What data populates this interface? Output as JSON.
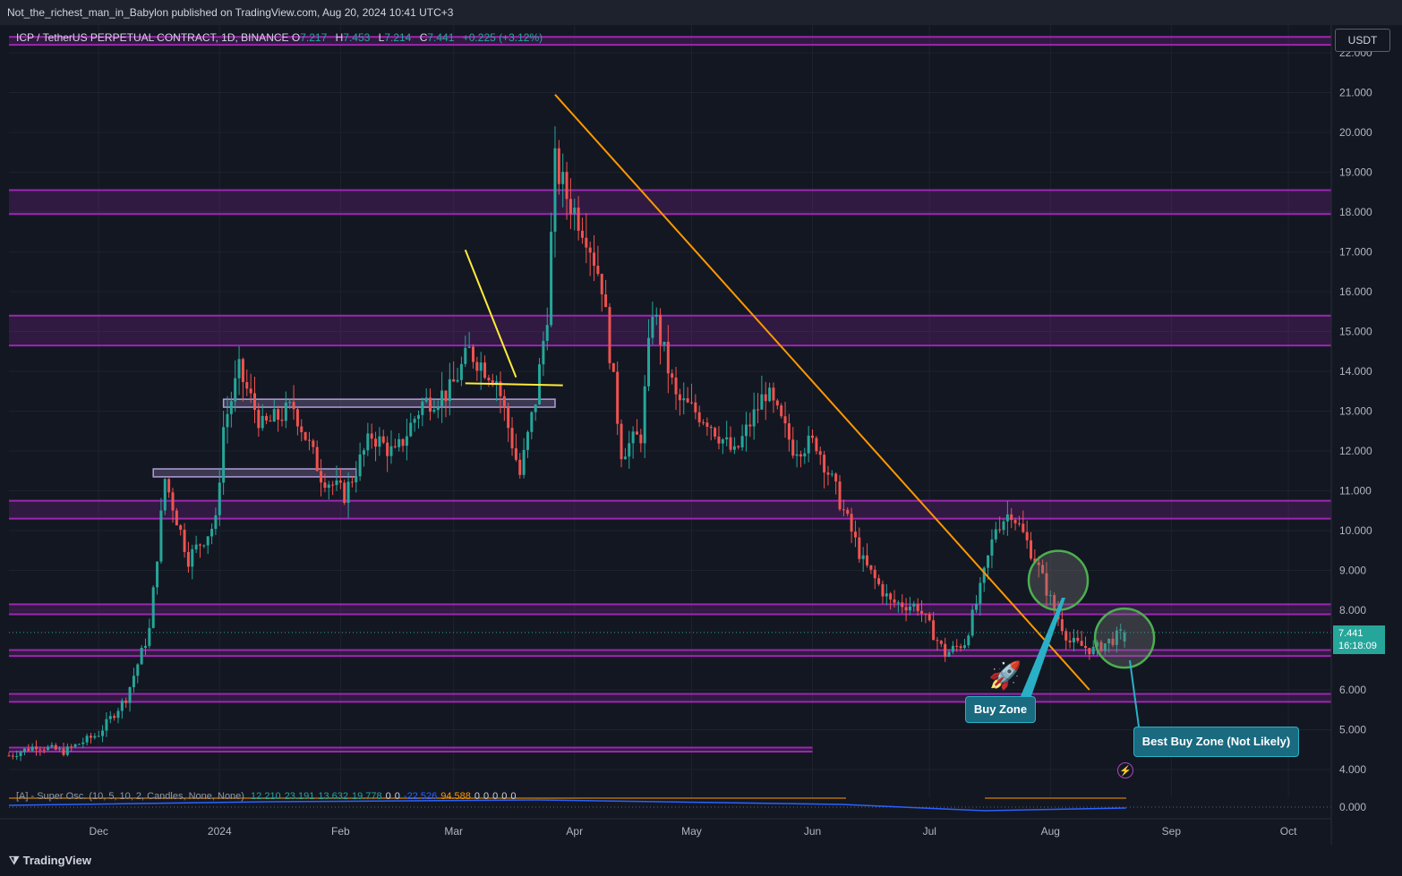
{
  "header": {
    "publisher": "Not_the_richest_man_in_Babylon published on TradingView.com, Aug 20, 2024 10:41 UTC+3"
  },
  "legend": {
    "symbol": "ICP / TetherUS PERPETUAL CONTRACT, 1D, BINANCE",
    "open_label": "O",
    "open": "7.217",
    "high_label": "H",
    "high": "7.453",
    "low_label": "L",
    "low": "7.214",
    "close_label": "C",
    "close": "7.441",
    "change": "+0.225 (+3.12%)"
  },
  "currency_button": "USDT",
  "price_label": {
    "price": "7.441",
    "countdown": "16:18:09"
  },
  "annotations": {
    "buy_zone": "Buy Zone",
    "best_buy_zone": "Best Buy Zone (Not Likely)",
    "rocket_icon": "🚀",
    "flash_icon": "⚡"
  },
  "indicator": {
    "name": "[A] - Super Osc. (10, 5, 10, 2, Candles, None, None)",
    "values": [
      "12.210",
      "23.191",
      "13.632",
      "19.778",
      "0",
      "0",
      "-22.526",
      "94.588",
      "0",
      "0",
      "0",
      "0",
      "0"
    ],
    "value_colors": [
      "#26a69a",
      "#26a69a",
      "#26a69a",
      "#26a69a",
      "#d1d4dc",
      "#d1d4dc",
      "#2962ff",
      "#ff9800",
      "#d1d4dc",
      "#d1d4dc",
      "#d1d4dc",
      "#d1d4dc",
      "#d1d4dc"
    ],
    "axis_label": "0.000"
  },
  "footer": {
    "brand": "TradingView",
    "logo_icon": "tradingview-logo"
  },
  "chart_data": {
    "type": "candlestick",
    "y_axis": {
      "ticks": [
        "22.000",
        "21.000",
        "20.000",
        "19.000",
        "18.000",
        "17.000",
        "16.000",
        "15.000",
        "14.000",
        "13.000",
        "12.000",
        "11.000",
        "10.000",
        "9.000",
        "8.000",
        "6.000",
        "5.000",
        "4.000"
      ],
      "range": [
        3.3,
        22.4
      ]
    },
    "x_axis": {
      "ticks": [
        "Dec",
        "2024",
        "Feb",
        "Mar",
        "Apr",
        "May",
        "Jun",
        "Jul",
        "Aug",
        "Sep",
        "Oct"
      ],
      "tick_dates": [
        "2023-12-01",
        "2024-01-01",
        "2024-02-01",
        "2024-03-01",
        "2024-04-01",
        "2024-05-01",
        "2024-06-01",
        "2024-07-01",
        "2024-08-01",
        "2024-09-01",
        "2024-10-01"
      ],
      "range": [
        "2023-11-08",
        "2024-10-12"
      ]
    },
    "last_price": 7.441,
    "colors": {
      "up": "#26a69a",
      "down": "#ef5350",
      "zone": "#9c27b0",
      "trend": "#ff9800",
      "yellow": "#ffeb3b"
    },
    "series_anchors": [
      [
        "2023-11-08",
        4.35
      ],
      [
        "2023-11-15",
        4.6
      ],
      [
        "2023-11-22",
        4.45
      ],
      [
        "2023-12-01",
        4.9
      ],
      [
        "2023-12-08",
        5.8
      ],
      [
        "2023-12-14",
        7.5
      ],
      [
        "2023-12-18",
        11.3
      ],
      [
        "2023-12-24",
        9.3
      ],
      [
        "2023-12-31",
        10.2
      ],
      [
        "2024-01-02",
        12.6
      ],
      [
        "2024-01-06",
        14.0
      ],
      [
        "2024-01-12",
        12.6
      ],
      [
        "2024-01-20",
        13.1
      ],
      [
        "2024-01-27",
        11.4
      ],
      [
        "2024-02-02",
        10.9
      ],
      [
        "2024-02-09",
        12.4
      ],
      [
        "2024-02-15",
        11.9
      ],
      [
        "2024-02-22",
        13.2
      ],
      [
        "2024-02-29",
        13.5
      ],
      [
        "2024-03-05",
        14.5
      ],
      [
        "2024-03-12",
        13.8
      ],
      [
        "2024-03-18",
        11.4
      ],
      [
        "2024-03-22",
        13.3
      ],
      [
        "2024-03-25",
        15.5
      ],
      [
        "2024-03-27",
        19.2
      ],
      [
        "2024-03-30",
        18.4
      ],
      [
        "2024-04-04",
        17.5
      ],
      [
        "2024-04-08",
        16.2
      ],
      [
        "2024-04-13",
        12.0
      ],
      [
        "2024-04-18",
        12.4
      ],
      [
        "2024-04-21",
        15.6
      ],
      [
        "2024-04-27",
        13.3
      ],
      [
        "2024-05-05",
        12.8
      ],
      [
        "2024-05-12",
        11.9
      ],
      [
        "2024-05-20",
        13.5
      ],
      [
        "2024-05-27",
        12.1
      ],
      [
        "2024-06-02",
        12.2
      ],
      [
        "2024-06-07",
        11.0
      ],
      [
        "2024-06-14",
        9.2
      ],
      [
        "2024-06-21",
        8.2
      ],
      [
        "2024-06-28",
        8.1
      ],
      [
        "2024-07-05",
        6.9
      ],
      [
        "2024-07-10",
        7.2
      ],
      [
        "2024-07-14",
        8.5
      ],
      [
        "2024-07-18",
        10.1
      ],
      [
        "2024-07-22",
        10.5
      ],
      [
        "2024-07-28",
        9.3
      ],
      [
        "2024-08-02",
        8.0
      ],
      [
        "2024-08-06",
        7.2
      ],
      [
        "2024-08-12",
        7.0
      ],
      [
        "2024-08-20",
        7.441
      ]
    ],
    "zones": [
      {
        "from": "2023-11-08",
        "to": "2024-10-12",
        "y_lo": 22.2,
        "y_hi": 22.4
      },
      {
        "from": "2023-11-08",
        "to": "2024-10-12",
        "y_lo": 17.95,
        "y_hi": 18.55
      },
      {
        "from": "2023-11-08",
        "to": "2024-10-12",
        "y_lo": 14.65,
        "y_hi": 15.4
      },
      {
        "from": "2023-11-08",
        "to": "2024-10-12",
        "y_lo": 10.3,
        "y_hi": 10.75
      },
      {
        "from": "2023-11-08",
        "to": "2024-10-12",
        "y_lo": 7.9,
        "y_hi": 8.15
      },
      {
        "from": "2023-11-08",
        "to": "2024-10-12",
        "y_lo": 6.85,
        "y_hi": 7.0
      },
      {
        "from": "2023-11-08",
        "to": "2024-10-12",
        "y_lo": 5.7,
        "y_hi": 5.9
      },
      {
        "from": "2023-11-08",
        "to": "2024-06-01",
        "y_lo": 4.45,
        "y_hi": 4.55
      }
    ],
    "boxes": [
      {
        "from": "2023-12-15",
        "to": "2024-02-05",
        "y_lo": 11.35,
        "y_hi": 11.55
      },
      {
        "from": "2024-01-02",
        "to": "2024-03-27",
        "y_lo": 13.1,
        "y_hi": 13.3
      }
    ],
    "trendlines": [
      {
        "from": [
          "2024-03-27",
          20.95
        ],
        "to": [
          "2024-08-11",
          6.0
        ],
        "color": "#ff9800"
      },
      {
        "from": [
          "2024-03-04",
          17.05
        ],
        "to": [
          "2024-03-17",
          13.85
        ],
        "color": "#ffeb3b"
      },
      {
        "from": [
          "2024-03-04",
          13.7
        ],
        "to": [
          "2024-03-29",
          13.65
        ],
        "color": "#ffeb3b"
      }
    ],
    "circles": [
      {
        "date": "2024-08-03",
        "price": 8.75
      },
      {
        "date": "2024-08-20",
        "price": 7.3
      }
    ]
  }
}
